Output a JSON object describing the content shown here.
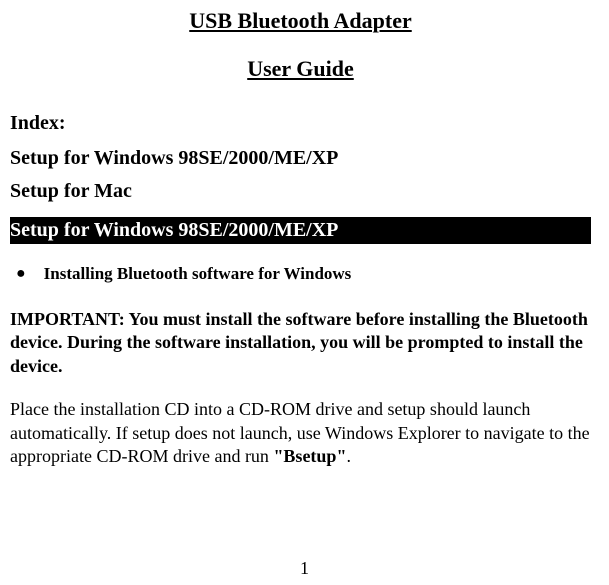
{
  "title": "USB Bluetooth Adapter",
  "subtitle": "User Guide",
  "index": {
    "heading": "Index:",
    "items": [
      "Setup for Windows 98SE/2000/ME/XP",
      "Setup for Mac"
    ]
  },
  "section": {
    "banner": "Setup for Windows 98SE/2000/ME/XP",
    "bullet": "Installing Bluetooth software for Windows",
    "important": "IMPORTANT: You must install the software before installing the Bluetooth device. During the software installation, you will be prompted to install the device.",
    "body_pre": "Place the installation CD into a CD-ROM drive and setup should launch automatically. If setup does not launch, use Windows Explorer to navigate to the appropriate CD-ROM drive and run ",
    "body_bold": "\"Bsetup\"",
    "body_post": "."
  },
  "page_number": "1"
}
